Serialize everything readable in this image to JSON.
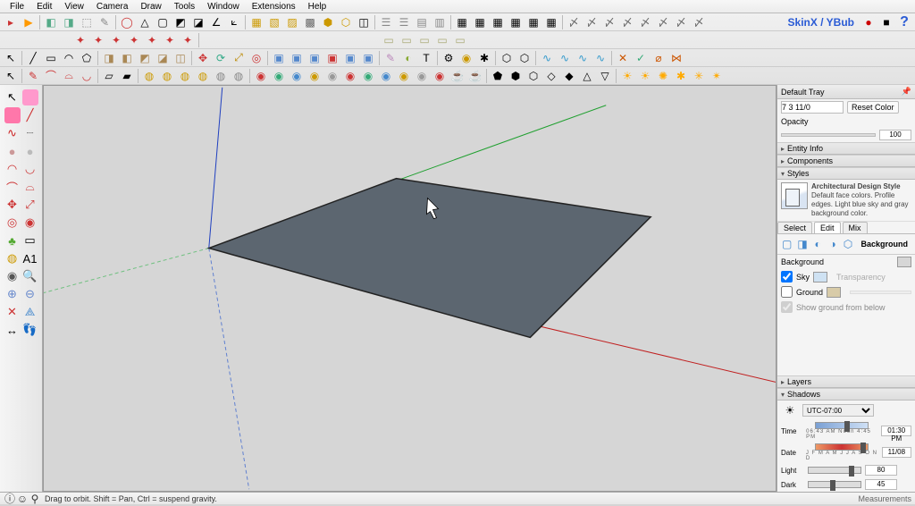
{
  "menu": [
    "File",
    "Edit",
    "View",
    "Camera",
    "Draw",
    "Tools",
    "Window",
    "Extensions",
    "Help"
  ],
  "skin_label": "SkinX / YBub",
  "tray": {
    "title": "Default Tray",
    "reset_color": "Reset Color",
    "opacity_label": "Opacity",
    "opacity_value": "100",
    "sections": {
      "entity": "Entity Info",
      "components": "Components",
      "styles": "Styles",
      "layers": "Layers",
      "shadows": "Shadows"
    },
    "style_name": "Architectural Design Style",
    "style_desc": "Default face colors. Profile edges. Light blue sky and gray background color.",
    "tabs": {
      "select": "Select",
      "edit": "Edit",
      "mix": "Mix"
    },
    "background_label": "Background",
    "bg_items": {
      "background": "Background",
      "sky": "Sky",
      "ground": "Ground",
      "belowtxt": "Show ground from below",
      "trans": "Transparency"
    }
  },
  "shadows": {
    "tz": "UTC-07:00",
    "time_label": "Time",
    "time_value": "01:30 PM",
    "time_scale": "06:43 AM  Noon  4:45 PM",
    "date_label": "Date",
    "date_value": "11/08",
    "date_scale": "J F M A M J J A S O N D",
    "light_label": "Light",
    "light_value": "80",
    "dark_label": "Dark",
    "dark_value": "45"
  },
  "status": {
    "hint": "Drag to orbit. Shift = Pan, Ctrl = suspend gravity.",
    "right": "Measurements"
  }
}
